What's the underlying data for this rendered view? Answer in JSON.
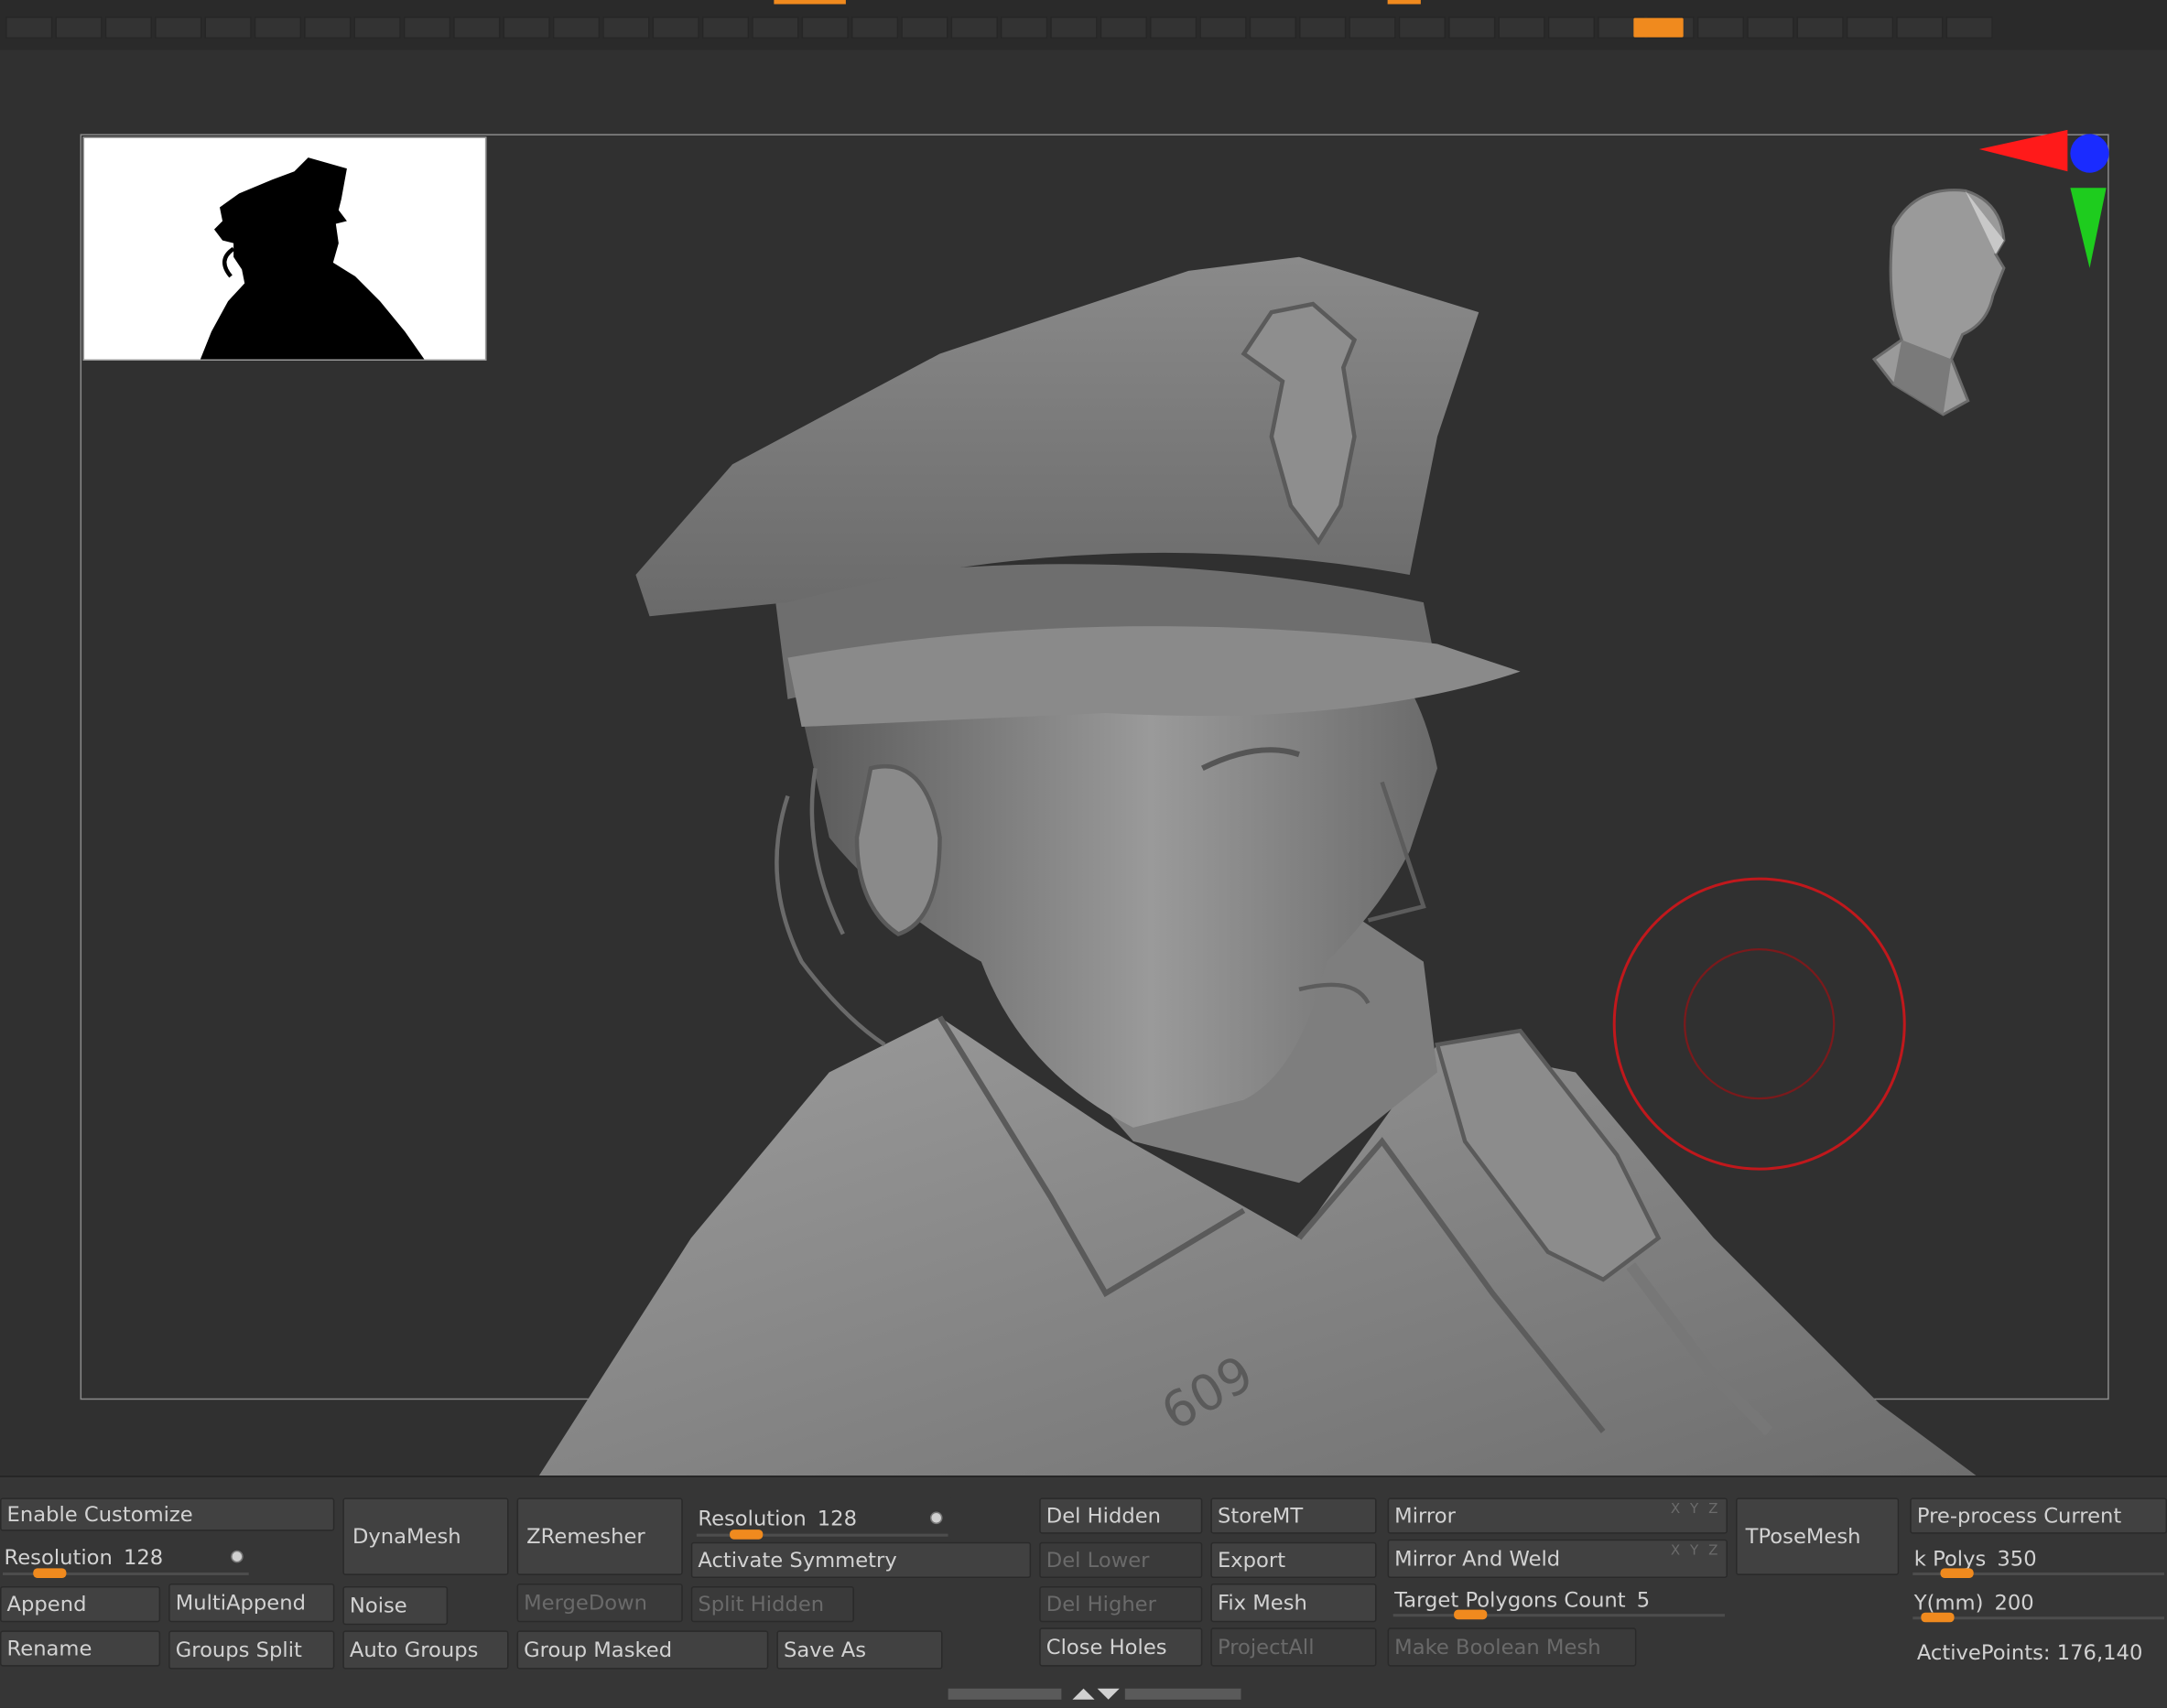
{
  "gizmo": {
    "axis_x_color": "#ff1a1a",
    "axis_y_color": "#1ecc1e",
    "axis_z_color": "#1a2bff"
  },
  "accent_color": "#f08a1e",
  "tool_panel": {
    "col1": {
      "enable_customize": "Enable Customize",
      "resolution_label": "Resolution",
      "resolution_value": "128",
      "resolution_fraction": 0.25,
      "append": "Append",
      "multi_append": "MultiAppend",
      "rename": "Rename",
      "groups_split": "Groups Split"
    },
    "col2": {
      "dynamesh": "DynaMesh",
      "noise": "Noise",
      "auto_groups": "Auto Groups"
    },
    "col3": {
      "zremesher": "ZRemesher",
      "merge_down": "MergeDown",
      "group_masked": "Group Masked"
    },
    "col4": {
      "resolution_label": "Resolution",
      "resolution_value": "128",
      "resolution_fraction": 0.25,
      "activate_symmetry": "Activate Symmetry",
      "split_hidden": "Split Hidden",
      "save_as": "Save As"
    },
    "col5": {
      "del_hidden": "Del Hidden",
      "del_lower": "Del Lower",
      "del_higher": "Del Higher",
      "close_holes": "Close Holes"
    },
    "col6": {
      "store_mt": "StoreMT",
      "export": "Export",
      "fix_mesh": "Fix Mesh",
      "project_all": "ProjectAll"
    },
    "col7": {
      "mirror": "Mirror",
      "mirror_and_weld": "Mirror And Weld",
      "target_polygons_label": "Target Polygons Count",
      "target_polygons_value": "5",
      "target_polygons_fraction": 0.22,
      "make_boolean_mesh": "Make Boolean Mesh",
      "xyz": "X Y Z"
    },
    "col8": {
      "tpose_mesh": "TPoseMesh"
    },
    "col9": {
      "preprocess_current": "Pre-process Current",
      "k_polys_label": "k Polys",
      "k_polys_value": "350",
      "k_polys_fraction": 0.2,
      "ymm_label": "Y(mm)",
      "ymm_value": "200",
      "ymm_fraction": 0.1,
      "active_points_label": "ActivePoints:",
      "active_points_value": "176,140"
    }
  }
}
